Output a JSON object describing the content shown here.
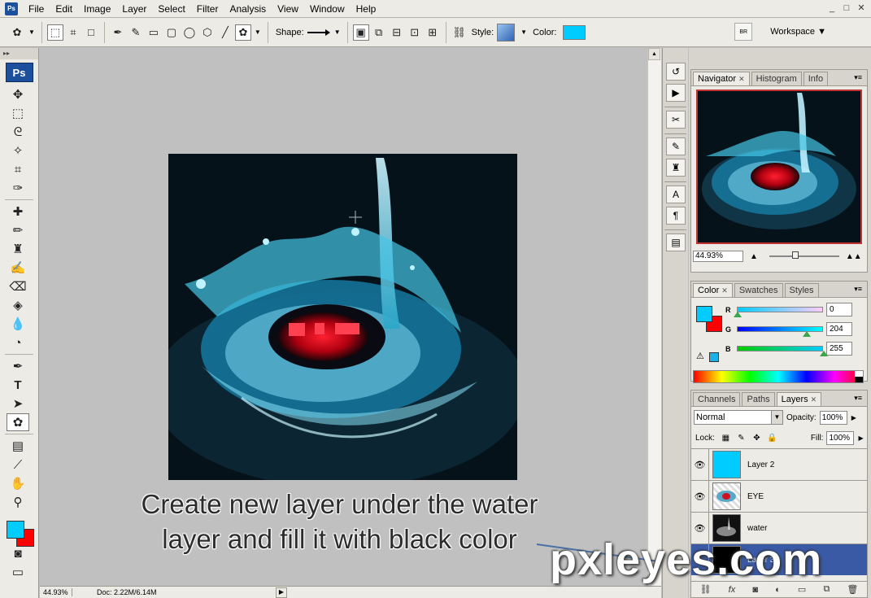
{
  "app": {
    "logo": "Ps",
    "menu": [
      "File",
      "Edit",
      "Image",
      "Layer",
      "Select",
      "Filter",
      "Analysis",
      "View",
      "Window",
      "Help"
    ],
    "window_controls": [
      "_",
      "□",
      "✕"
    ]
  },
  "options": {
    "shape_label": "Shape:",
    "style_label": "Style:",
    "color_label": "Color:",
    "color": "#00ccff",
    "workspace_label": "Workspace ▼",
    "workspace_icon": "BR"
  },
  "toolbar": {
    "header": "▸▸",
    "logo": "Ps",
    "fg_color": "#00ccff",
    "bg_color": "#ff0000"
  },
  "status": {
    "zoom": "44.93%",
    "doc": "Doc: 2.22M/6.14M"
  },
  "caption": {
    "text": "Create new layer under the water layer and fill it with black color"
  },
  "watermark": "pxleyes.com",
  "panels": {
    "navigator": {
      "tabs": [
        "Navigator",
        "Histogram",
        "Info"
      ],
      "zoom": "44.93%"
    },
    "color": {
      "tabs": [
        "Color",
        "Swatches",
        "Styles"
      ],
      "r_label": "R",
      "g_label": "G",
      "b_label": "B",
      "r": "0",
      "g": "204",
      "b": "255",
      "fg": "#00ccff",
      "bg": "#ff0000"
    },
    "layers": {
      "tabs": [
        "Channels",
        "Paths",
        "Layers"
      ],
      "blend_mode": "Normal",
      "opacity_label": "Opacity:",
      "opacity": "100%",
      "lock_label": "Lock:",
      "fill_label": "Fill:",
      "fill": "100%",
      "items": [
        {
          "name": "Layer 2",
          "selected": false
        },
        {
          "name": "EYE",
          "selected": false
        },
        {
          "name": "water",
          "selected": false
        },
        {
          "name": "Layer 3",
          "selected": true
        }
      ],
      "footer_icons": [
        "link-icon",
        "fx-icon",
        "mask-icon",
        "adjustment-icon",
        "group-icon",
        "new-layer-icon",
        "trash-icon"
      ]
    }
  }
}
